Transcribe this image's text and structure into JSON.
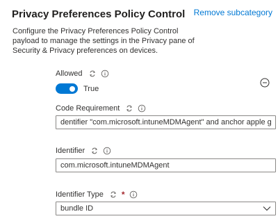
{
  "header": {
    "title": "Privacy Preferences Policy Control",
    "remove_link": "Remove subcategory",
    "description": "Configure the Privacy Preferences Policy Control payload to manage the settings in the Privacy pane of Security & Privacy preferences on devices."
  },
  "fields": {
    "allowed": {
      "label": "Allowed",
      "toggle_on": true,
      "toggle_text": "True"
    },
    "code_requirement": {
      "label": "Code Requirement",
      "value": "dentifier \"com.microsoft.intuneMDMAgent\" and anchor apple generi..."
    },
    "identifier": {
      "label": "Identifier",
      "value": "com.microsoft.intuneMDMAgent"
    },
    "identifier_type": {
      "label": "Identifier Type",
      "required_marker": "*",
      "selected": "bundle ID"
    }
  },
  "colors": {
    "accent": "#0078d4",
    "required": "#a4262c",
    "border": "#8a8886"
  },
  "icons": {
    "sync": "sync-icon",
    "info": "info-icon",
    "remove": "minus-circle-icon",
    "dropdown": "chevron-down-icon"
  }
}
